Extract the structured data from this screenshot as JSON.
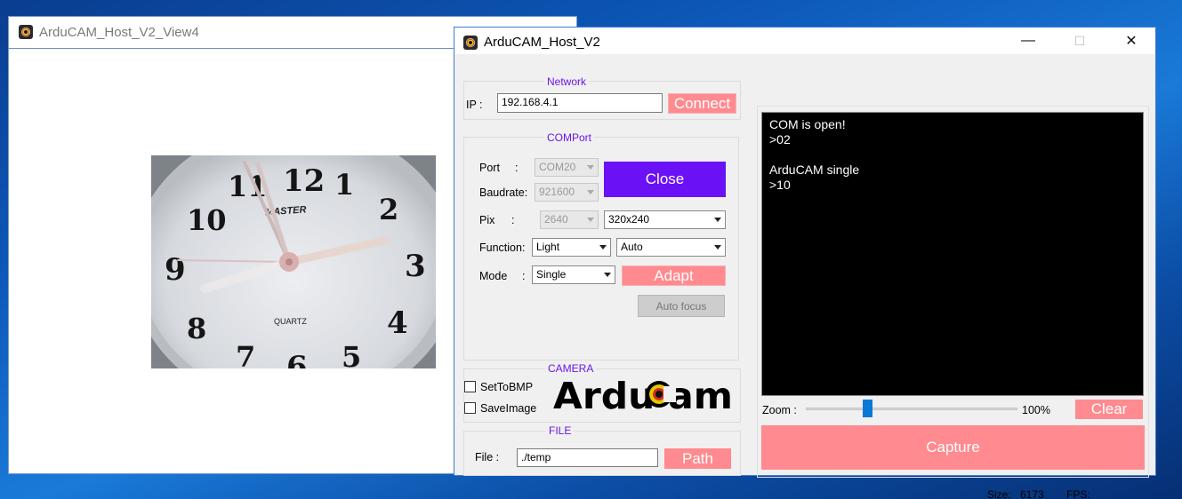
{
  "view_window": {
    "title": "ArduCAM_Host_V2_View4"
  },
  "main_window": {
    "title": "ArduCAM_Host_V2",
    "minimize": "—",
    "maximize": "☐",
    "close": "✕"
  },
  "network": {
    "group": "Network",
    "ip_label": "IP :",
    "ip_value": "192.168.4.1",
    "connect": "Connect"
  },
  "comport": {
    "group": "COMPort",
    "port_label": "Port",
    "colon": ":",
    "port_value": "COM20",
    "baud_label": "Baudrate:",
    "baud_value": "921600",
    "close": "Close",
    "pix_label": "Pix",
    "pix_value": "2640",
    "resolution": "320x240",
    "function_label": "Function:",
    "function_value": "Light",
    "function_mode": "Auto",
    "mode_label": "Mode",
    "mode_value": "Single",
    "adapt": "Adapt",
    "autofocus": "Auto focus"
  },
  "camera": {
    "group": "CAMERA",
    "set_to_bmp": "SetToBMP",
    "save_image": "SaveImage",
    "logo_text": "ArduCam"
  },
  "file": {
    "group": "FILE",
    "file_label": "File :",
    "path_value": "./temp",
    "path_button": "Path"
  },
  "console": {
    "lines": [
      "COM is open!",
      ">02",
      "",
      "ArduCAM single",
      ">10"
    ]
  },
  "zoom": {
    "label": "Zoom :",
    "value": 0.28,
    "percent": "100%",
    "clear": "Clear"
  },
  "capture": "Capture",
  "status": {
    "size_label": "Size:",
    "size_value": "6173",
    "fps_label": "FPS:",
    "fps_value": ""
  },
  "clock_numbers": [
    "12",
    "1",
    "2",
    "3",
    "4",
    "5",
    "6",
    "7",
    "8",
    "9",
    "10",
    "11"
  ],
  "clock_brand": "MASTER",
  "clock_quartz": "QUARTZ"
}
